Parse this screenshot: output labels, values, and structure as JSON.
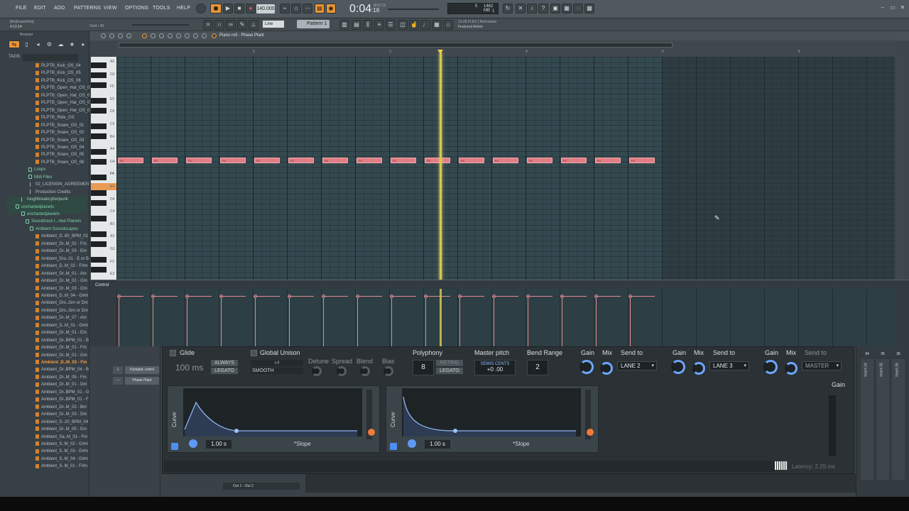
{
  "menu": [
    "FILE",
    "EDIT",
    "ADD",
    "PATTERNS",
    "VIEW",
    "OPTIONS",
    "TOOLS",
    "HELP"
  ],
  "transport": {
    "tempo": "140.000",
    "time_main": "0:04",
    "time_sub": "16",
    "time_ms_label": "M:S:CS",
    "cpu_value": "5",
    "ram_value": "1462 MB",
    "ram_sub": "1"
  },
  "hint": {
    "line1": "[Andreasmfola]",
    "line2": "4:12:14",
    "position": "Oct4 / 49"
  },
  "toolbar": {
    "pattern": "Pattern 1",
    "snap": "Line"
  },
  "news": {
    "line1": "13.06  FLEX | Retrowave",
    "line2": "Featured Artists"
  },
  "browser": {
    "title": "Browser",
    "tags_label": "TAGS",
    "items": [
      {
        "label": "PLPTB_Kick_OS_04",
        "type": "audio",
        "indent": 50
      },
      {
        "label": "PLPTB_Kick_OS_05",
        "type": "audio",
        "indent": 50
      },
      {
        "label": "PLPTB_Kick_OS_06",
        "type": "audio",
        "indent": 50
      },
      {
        "label": "PLPTB_Open_Hat_OS_01",
        "type": "audio",
        "indent": 50
      },
      {
        "label": "PLPTB_Open_Hat_OS_02",
        "type": "audio",
        "indent": 50
      },
      {
        "label": "PLPTB_Open_Hat_OS_03",
        "type": "audio",
        "indent": 50
      },
      {
        "label": "PLPTB_Open_Hat_OS_04",
        "type": "audio",
        "indent": 50
      },
      {
        "label": "PLPTB_Ride_OS",
        "type": "audio",
        "indent": 50
      },
      {
        "label": "PLPTB_Snare_OS_01",
        "type": "audio",
        "indent": 50
      },
      {
        "label": "PLPTB_Snare_OS_02",
        "type": "audio",
        "indent": 50
      },
      {
        "label": "PLPTB_Snare_OS_03",
        "type": "audio",
        "indent": 50
      },
      {
        "label": "PLPTB_Snare_OS_04",
        "type": "audio",
        "indent": 50
      },
      {
        "label": "PLPTB_Snare_OS_05",
        "type": "audio",
        "indent": 50
      },
      {
        "label": "PLPTB_Snare_OS_06",
        "type": "audio",
        "indent": 50
      },
      {
        "label": "Loops",
        "type": "folder",
        "indent": 40
      },
      {
        "label": "Midi Files",
        "type": "folder",
        "indent": 40
      },
      {
        "label": "02_LICENSIN_AGREEMENT",
        "type": "text",
        "indent": 42
      },
      {
        "label": "Production Credits",
        "type": "text",
        "indent": 42
      },
      {
        "label": "toughbreakcyberpunk",
        "type": "text",
        "indent": 30
      },
      {
        "label": "unchartedplanets",
        "type": "folder",
        "indent": 22
      },
      {
        "label": "unchartedplanets",
        "type": "folder",
        "indent": 30
      },
      {
        "label": "Soundtrack l...rted Planets",
        "type": "folder",
        "indent": 36
      },
      {
        "label": "Ambient Soundscapes",
        "type": "folder",
        "indent": 42
      },
      {
        "label": "Ambient_D..60_BPM_01",
        "type": "audio",
        "indent": 50
      },
      {
        "label": "Ambient_Dr..M_02 - Fm",
        "type": "audio",
        "indent": 50
      },
      {
        "label": "Ambient_Dr..M_03 - Em",
        "type": "audio",
        "indent": 50
      },
      {
        "label": "Ambient_Dro..01 - E or B",
        "type": "audio",
        "indent": 50
      },
      {
        "label": "Ambient_D..M_02 - F#m",
        "type": "audio",
        "indent": 50
      },
      {
        "label": "Ambient_Dr..M_01 - Am",
        "type": "audio",
        "indent": 50
      },
      {
        "label": "Ambient_Dr..M_02 - Gm",
        "type": "audio",
        "indent": 50
      },
      {
        "label": "Ambient_Dr..M_03 - Gm",
        "type": "audio",
        "indent": 50
      },
      {
        "label": "Ambient_D..M_04 - G#m",
        "type": "audio",
        "indent": 50
      },
      {
        "label": "Ambient_Dro..Gm or Dm",
        "type": "audio",
        "indent": 50
      },
      {
        "label": "Ambient_Dro..Gm or Dm",
        "type": "audio",
        "indent": 50
      },
      {
        "label": "Ambient_Dr..M_07 - Am",
        "type": "audio",
        "indent": 50
      },
      {
        "label": "Ambient_D..M_01 - G#m",
        "type": "audio",
        "indent": 50
      },
      {
        "label": "Ambient_Dr..M_01 - Em",
        "type": "audio",
        "indent": 50
      },
      {
        "label": "Ambient_Dr..BPM_01 - B",
        "type": "audio",
        "indent": 50
      },
      {
        "label": "Ambient_Dr..M_01 - Fm",
        "type": "audio",
        "indent": 50
      },
      {
        "label": "Ambient_Dr..M_01 - Gm",
        "type": "audio",
        "indent": 50
      },
      {
        "label": "Ambient_D..M_03 - Fm",
        "type": "audio",
        "indent": 50,
        "selected": true
      },
      {
        "label": "Ambient_Dr..BPM_04 - B",
        "type": "audio",
        "indent": 50
      },
      {
        "label": "Ambient_Dr..M_05 - Fm",
        "type": "audio",
        "indent": 50
      },
      {
        "label": "Ambient_Dr..M_01 - Dm",
        "type": "audio",
        "indent": 50
      },
      {
        "label": "Ambient_Dr..BPM_01 - G",
        "type": "audio",
        "indent": 50
      },
      {
        "label": "Ambient_Dr..BPM_01 - F",
        "type": "audio",
        "indent": 50
      },
      {
        "label": "Ambient_Dr..M_02 - Bm",
        "type": "audio",
        "indent": 50
      },
      {
        "label": "Ambient_Dr..M_03 - Dm",
        "type": "audio",
        "indent": 50
      },
      {
        "label": "Ambient_D..20_BPM_04",
        "type": "audio",
        "indent": 50
      },
      {
        "label": "Ambient_Dr..M_05 - Em",
        "type": "audio",
        "indent": 50
      },
      {
        "label": "Ambient_Sa..M_01 - Fm",
        "type": "audio",
        "indent": 50
      },
      {
        "label": "Ambient_S..M_02 - G#m",
        "type": "audio",
        "indent": 50
      },
      {
        "label": "Ambient_S..M_03 - G#m",
        "type": "audio",
        "indent": 50
      },
      {
        "label": "Ambient_S..M_04 - G#m",
        "type": "audio",
        "indent": 50
      },
      {
        "label": "Ambient_S..M_01 - F#m",
        "type": "audio",
        "indent": 50
      }
    ]
  },
  "piano_roll": {
    "title": "Piano roll - Phase Plant",
    "bar_numbers": [
      "2",
      "3",
      "4",
      "5",
      "6"
    ],
    "key_labels": [
      "A5",
      "G5",
      "F5",
      "E5",
      "D5",
      "C5",
      "B4",
      "A4",
      "G4",
      "F4",
      "E4",
      "D4",
      "C4",
      "B3",
      "A3",
      "G3",
      "F3",
      "E3",
      "D3",
      "C3"
    ],
    "highlight_key": "F4",
    "note_label": "F4",
    "note_count": 16,
    "playhead_bar": 3.87,
    "control_label": "Control"
  },
  "channels": [
    {
      "num": "1",
      "name": "Komplet..ontrol"
    },
    {
      "num": "---",
      "name": "Phase Plant"
    }
  ],
  "plant": {
    "glide_label": "Glide",
    "glide_value": "100 ms",
    "always": "ALWAYS",
    "legato": "LEGATO",
    "unison_label": "Global Unison",
    "unison_value": "x4",
    "unison_mode": "SMOOTH",
    "detune": "Detune",
    "spread": "Spread",
    "blend": "Blend",
    "bias": "Bias",
    "polyphony_label": "Polyphony",
    "polyphony_value": "8",
    "retrig": "RETRIG",
    "legato2": "LEGATO",
    "master_pitch_label": "Master pitch",
    "semis_cents": "SEMIS CENTS",
    "pitch_value": "+0 .00",
    "bend_label": "Bend Range",
    "bend_value": "2",
    "gain": "Gain",
    "mix": "Mix",
    "send_to": "Send to",
    "lanes": [
      "LANE 2",
      "LANE 3",
      "MASTER"
    ],
    "env1": {
      "label": "Curve",
      "time": "1.00 s",
      "slope": "*Slope"
    },
    "env2": {
      "label": "Curve",
      "time": "1.00 s",
      "slope": "*Slope"
    },
    "gain_right": "Gain",
    "latency": "Latency: 2.29 ms"
  },
  "mixer": {
    "strips": [
      {
        "num": "34",
        "label": "Insert 34"
      },
      {
        "num": "35",
        "label": "Insert 35"
      },
      {
        "num": "36",
        "label": "Insert 36"
      }
    ]
  },
  "output": "Out 1 - Out 2",
  "colors": {
    "accent_orange": "#e8953a",
    "note_pink": "#e07e86",
    "playhead": "#d8c84a",
    "folder_green": "#7fd0a5",
    "knob_blue": "#6ea6ff"
  }
}
